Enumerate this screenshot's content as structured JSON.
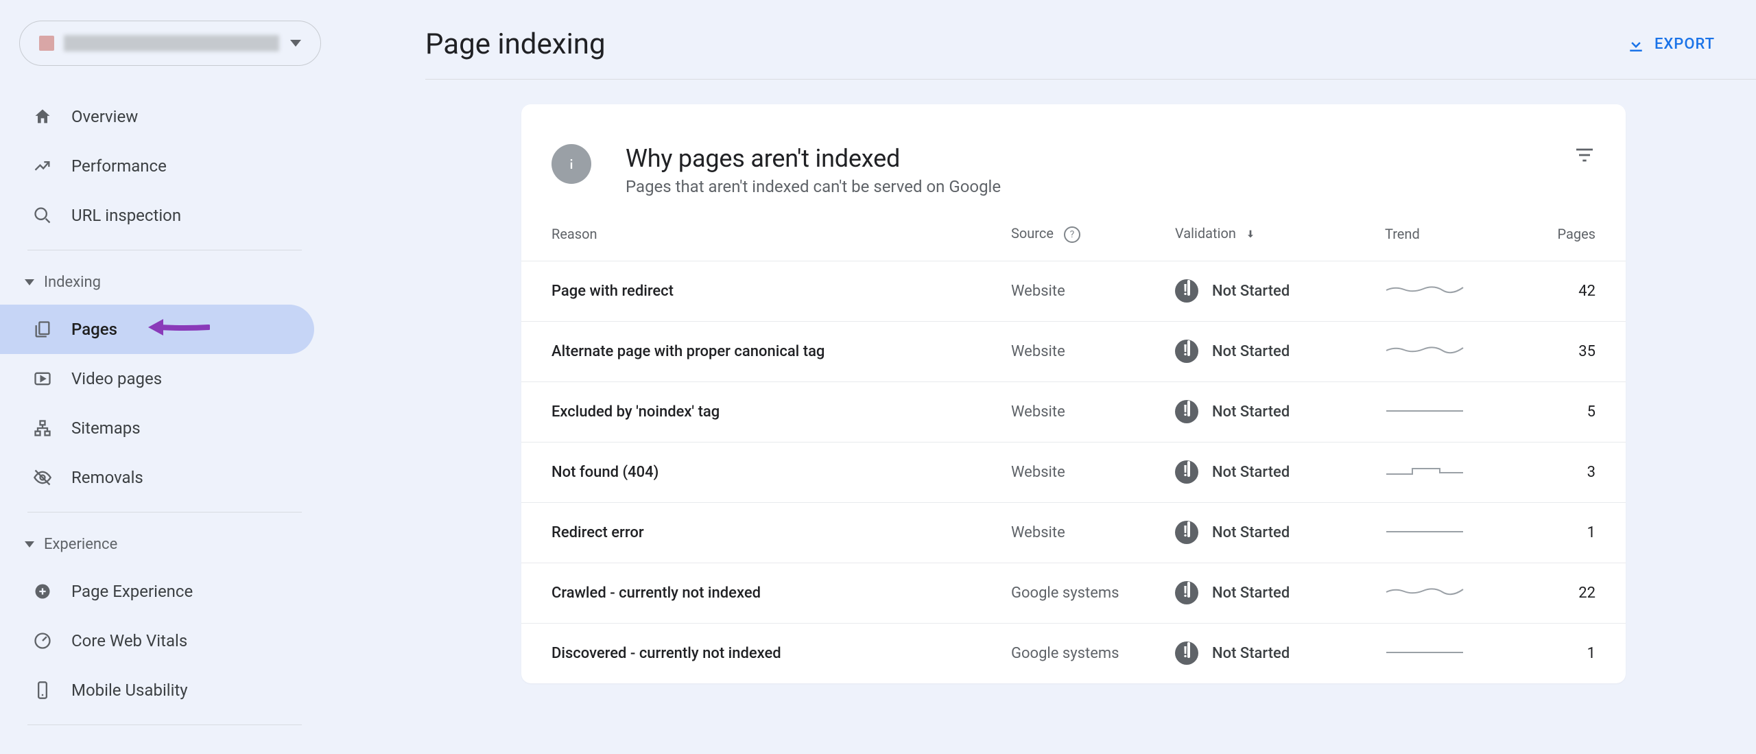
{
  "header": {
    "title": "Page indexing",
    "export": "EXPORT"
  },
  "sidebar": {
    "property_placeholder": " ",
    "top": [
      {
        "label": "Overview"
      },
      {
        "label": "Performance"
      },
      {
        "label": "URL inspection"
      }
    ],
    "indexing_label": "Indexing",
    "indexing": [
      {
        "label": "Pages"
      },
      {
        "label": "Video pages"
      },
      {
        "label": "Sitemaps"
      },
      {
        "label": "Removals"
      }
    ],
    "experience_label": "Experience",
    "experience": [
      {
        "label": "Page Experience"
      },
      {
        "label": "Core Web Vitals"
      },
      {
        "label": "Mobile Usability"
      }
    ]
  },
  "card": {
    "title": "Why pages aren't indexed",
    "subtitle": "Pages that aren't indexed can't be served on Google",
    "columns": {
      "reason": "Reason",
      "source": "Source",
      "validation": "Validation",
      "trend": "Trend",
      "pages": "Pages"
    },
    "rows": [
      {
        "reason": "Page with redirect",
        "source": "Website",
        "validation": "Not Started",
        "trend": "wavy",
        "pages": "42"
      },
      {
        "reason": "Alternate page with proper canonical tag",
        "source": "Website",
        "validation": "Not Started",
        "trend": "wavy",
        "pages": "35"
      },
      {
        "reason": "Excluded by 'noindex' tag",
        "source": "Website",
        "validation": "Not Started",
        "trend": "flat",
        "pages": "5"
      },
      {
        "reason": "Not found (404)",
        "source": "Website",
        "validation": "Not Started",
        "trend": "step",
        "pages": "3"
      },
      {
        "reason": "Redirect error",
        "source": "Website",
        "validation": "Not Started",
        "trend": "flat",
        "pages": "1"
      },
      {
        "reason": "Crawled - currently not indexed",
        "source": "Google systems",
        "validation": "Not Started",
        "trend": "wavy",
        "pages": "22"
      },
      {
        "reason": "Discovered - currently not indexed",
        "source": "Google systems",
        "validation": "Not Started",
        "trend": "flat",
        "pages": "1"
      }
    ]
  }
}
